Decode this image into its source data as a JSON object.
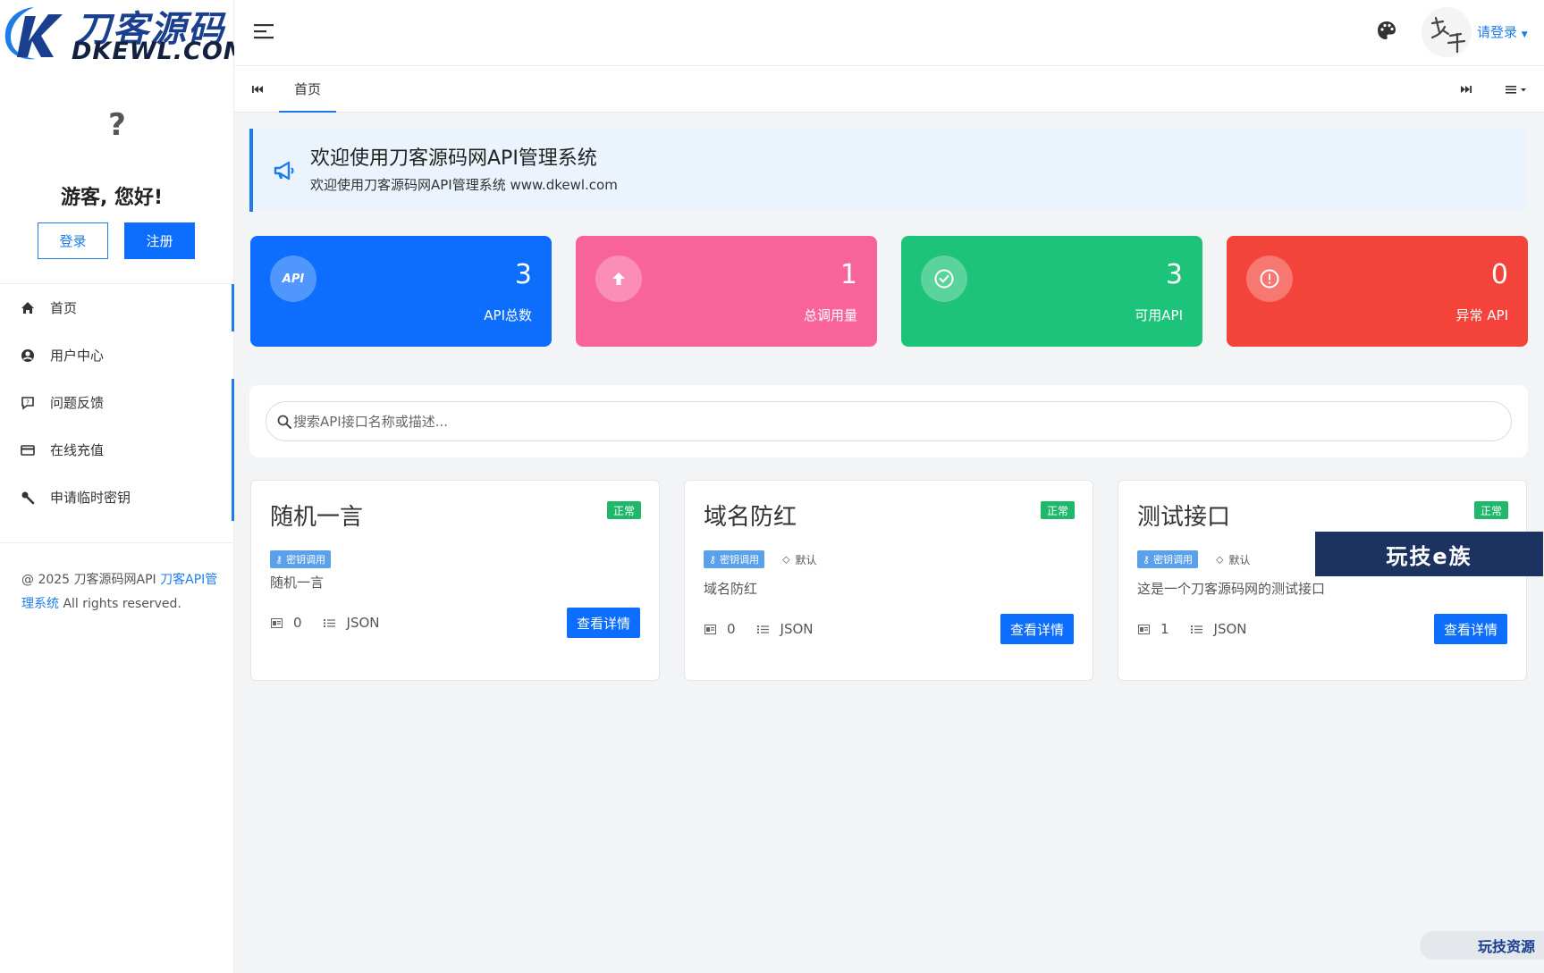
{
  "brand": {
    "logo_cn": "刀客源码",
    "logo_en": "DKEWL.COM"
  },
  "sidebar": {
    "avatar_glyph": "?",
    "greeting": "游客, 您好!",
    "login_label": "登录",
    "register_label": "注册",
    "items": [
      {
        "label": "首页",
        "icon": "home-icon"
      },
      {
        "label": "用户中心",
        "icon": "user-circle-icon"
      },
      {
        "label": "问题反馈",
        "icon": "feedback-icon"
      },
      {
        "label": "在线充值",
        "icon": "credit-card-icon"
      },
      {
        "label": "申请临时密钥",
        "icon": "wrench-icon"
      }
    ],
    "copyright": {
      "prefix": "@ 2025 刀客源码网API ",
      "link": "刀客API管理系统",
      "suffix": " All rights reserved."
    }
  },
  "header": {
    "login_prompt": "请登录"
  },
  "tabs": {
    "home": "首页"
  },
  "notice": {
    "title": "欢迎使用刀客源码网API管理系统",
    "subtitle": "欢迎使用刀客源码网API管理系统 www.dkewl.com"
  },
  "stats": [
    {
      "icon_text": "API",
      "value": "3",
      "label": "API总数",
      "color": "#0d6efd"
    },
    {
      "icon_text": "",
      "value": "1",
      "label": "总调用量",
      "color": "#f8639a"
    },
    {
      "icon_text": "",
      "value": "3",
      "label": "可用API",
      "color": "#1dc378"
    },
    {
      "icon_text": "",
      "value": "0",
      "label": "异常 API",
      "color": "#f4433b"
    }
  ],
  "search": {
    "placeholder": "搜索API接口名称或描述..."
  },
  "apis": [
    {
      "title": "随机一言",
      "status": "正常",
      "auth_tag": "密钥调用",
      "category": "",
      "description": "随机一言",
      "calls": "0",
      "format": "JSON",
      "button": "查看详情"
    },
    {
      "title": "域名防红",
      "status": "正常",
      "auth_tag": "密钥调用",
      "category": "默认",
      "description": "域名防红",
      "calls": "0",
      "format": "JSON",
      "button": "查看详情"
    },
    {
      "title": "测试接口",
      "status": "正常",
      "auth_tag": "密钥调用",
      "category": "默认",
      "description": "这是一个刀客源码网的测试接口",
      "calls": "1",
      "format": "JSON",
      "button": "查看详情"
    }
  ],
  "watermarks": {
    "overlay": "玩技e族",
    "corner": "玩技资源"
  },
  "colors": {
    "accent": "#0d6efd",
    "status_ok": "#1fb86a",
    "key_tag": "#5aa0ea"
  }
}
